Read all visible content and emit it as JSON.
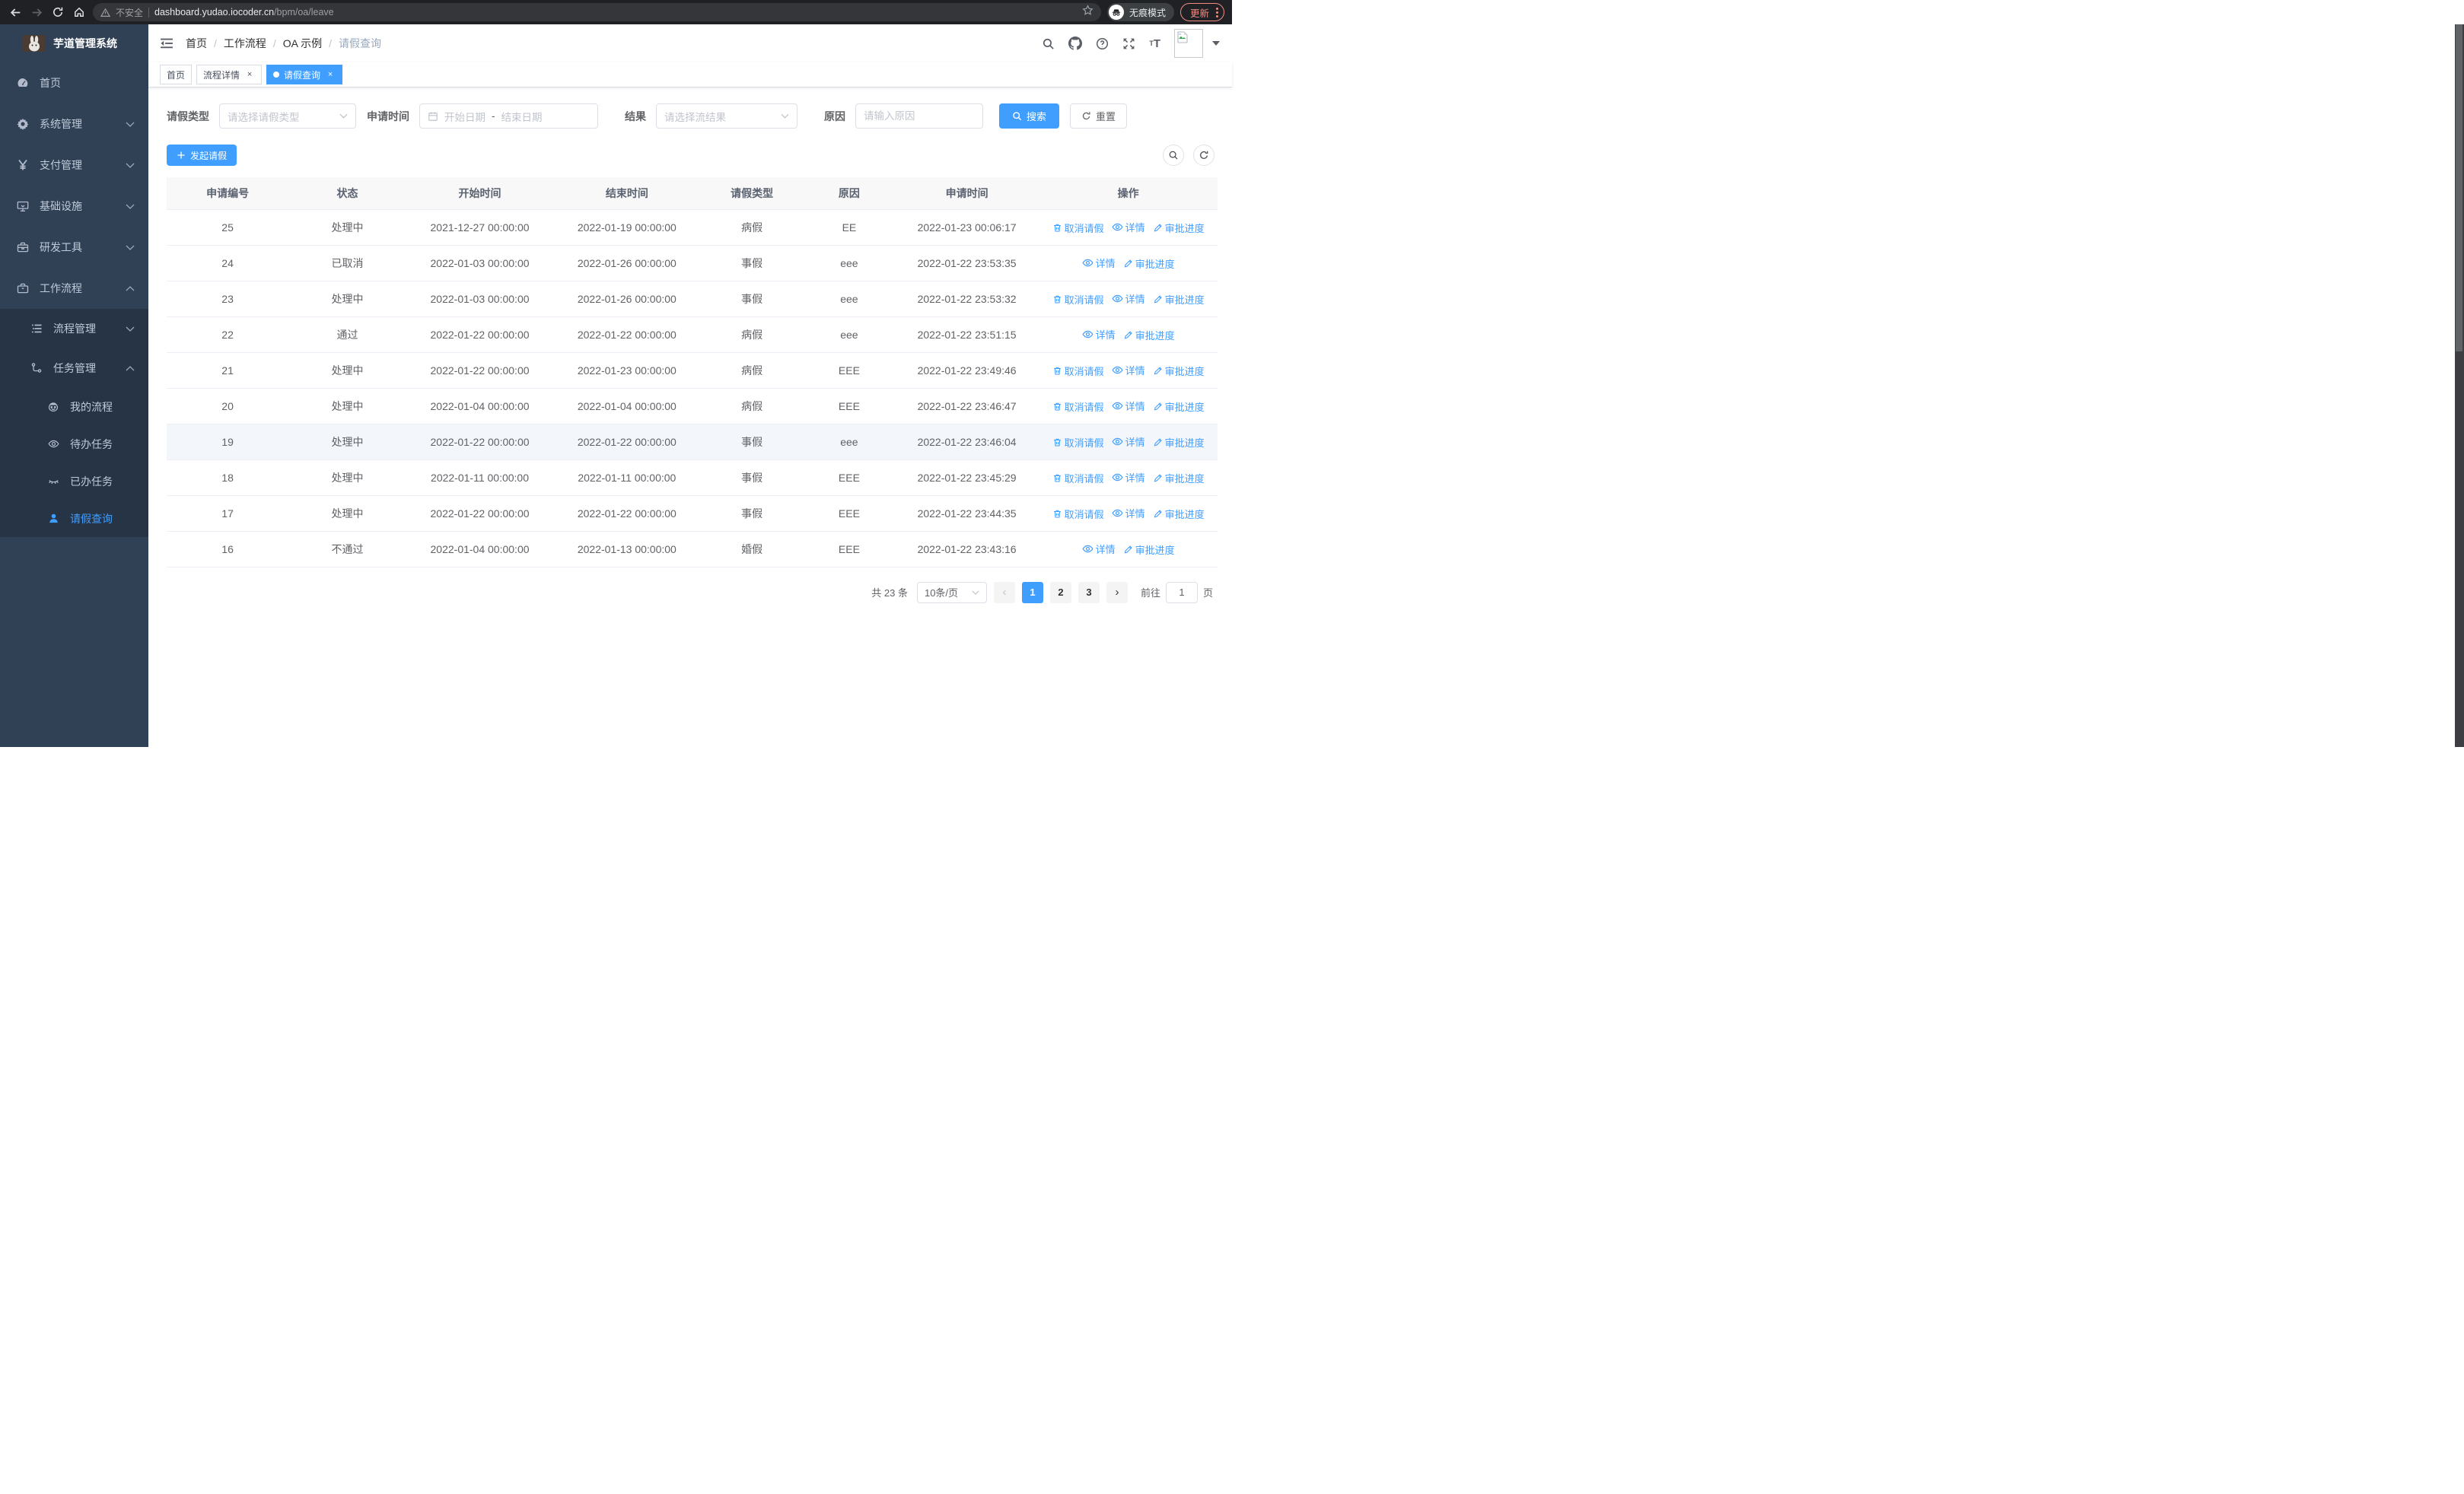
{
  "browser": {
    "security_text": "不安全",
    "url_host": "dashboard.yudao.iocoder.cn",
    "url_path": "/bpm/oa/leave",
    "incognito_label": "无痕模式",
    "update_label": "更新"
  },
  "sidebar": {
    "logo_title": "芋道管理系统",
    "menu": [
      {
        "label": "首页",
        "icon": "dashboard-icon",
        "level": 1,
        "chevron": "",
        "active": false
      },
      {
        "label": "系统管理",
        "icon": "gear-icon",
        "level": 1,
        "chevron": "down",
        "active": false
      },
      {
        "label": "支付管理",
        "icon": "yen-icon",
        "level": 1,
        "chevron": "down",
        "active": false
      },
      {
        "label": "基础设施",
        "icon": "monitor-icon",
        "level": 1,
        "chevron": "down",
        "active": false
      },
      {
        "label": "研发工具",
        "icon": "toolbox-icon",
        "level": 1,
        "chevron": "down",
        "active": false
      },
      {
        "label": "工作流程",
        "icon": "briefcase-icon",
        "level": 1,
        "chevron": "up",
        "active": false
      },
      {
        "label": "流程管理",
        "icon": "list-icon",
        "level": 2,
        "chevron": "down",
        "active": false,
        "sub": true
      },
      {
        "label": "任务管理",
        "icon": "branch-icon",
        "level": 2,
        "chevron": "up",
        "active": false,
        "sub": true
      },
      {
        "label": "我的流程",
        "icon": "robot-icon",
        "level": 3,
        "chevron": "",
        "active": false,
        "sub": true
      },
      {
        "label": "待办任务",
        "icon": "eye-icon",
        "level": 3,
        "chevron": "",
        "active": false,
        "sub": true
      },
      {
        "label": "已办任务",
        "icon": "eye-closed-icon",
        "level": 3,
        "chevron": "",
        "active": false,
        "sub": true
      },
      {
        "label": "请假查询",
        "icon": "user-icon",
        "level": 3,
        "chevron": "",
        "active": true,
        "sub": true
      }
    ]
  },
  "navbar": {
    "icons": [
      "search-icon",
      "github-icon",
      "help-icon",
      "fullscreen-icon",
      "font-size-icon"
    ]
  },
  "breadcrumb": {
    "items": [
      "首页",
      "工作流程",
      "OA 示例"
    ],
    "current": "请假查询"
  },
  "tabs": [
    {
      "label": "首页",
      "closable": false,
      "active": false
    },
    {
      "label": "流程详情",
      "closable": true,
      "active": false
    },
    {
      "label": "请假查询",
      "closable": true,
      "active": true
    }
  ],
  "filters": {
    "leave_type_label": "请假类型",
    "leave_type_placeholder": "请选择请假类型",
    "apply_time_label": "申请时间",
    "start_date_placeholder": "开始日期",
    "date_separator": "-",
    "end_date_placeholder": "结束日期",
    "result_label": "结果",
    "result_placeholder": "请选择流结果",
    "reason_label": "原因",
    "reason_placeholder": "请输入原因",
    "search_label": "搜索",
    "reset_label": "重置"
  },
  "toolbar": {
    "create_label": "发起请假"
  },
  "table": {
    "headers": [
      "申请编号",
      "状态",
      "开始时间",
      "结束时间",
      "请假类型",
      "原因",
      "申请时间",
      "操作"
    ],
    "action_labels": {
      "cancel": "取消请假",
      "detail": "详情",
      "progress": "审批进度"
    },
    "action_icons": {
      "cancel": "trash-icon",
      "detail": "eye-icon",
      "progress": "edit-icon"
    },
    "rows": [
      {
        "id": "25",
        "status": "处理中",
        "start": "2021-12-27 00:00:00",
        "end": "2022-01-19 00:00:00",
        "type": "病假",
        "reason": "EE",
        "applied": "2022-01-23 00:06:17",
        "actions": [
          "cancel",
          "detail",
          "progress"
        ],
        "highlight": false
      },
      {
        "id": "24",
        "status": "已取消",
        "start": "2022-01-03 00:00:00",
        "end": "2022-01-26 00:00:00",
        "type": "事假",
        "reason": "eee",
        "applied": "2022-01-22 23:53:35",
        "actions": [
          "detail",
          "progress"
        ],
        "highlight": false
      },
      {
        "id": "23",
        "status": "处理中",
        "start": "2022-01-03 00:00:00",
        "end": "2022-01-26 00:00:00",
        "type": "事假",
        "reason": "eee",
        "applied": "2022-01-22 23:53:32",
        "actions": [
          "cancel",
          "detail",
          "progress"
        ],
        "highlight": false
      },
      {
        "id": "22",
        "status": "通过",
        "start": "2022-01-22 00:00:00",
        "end": "2022-01-22 00:00:00",
        "type": "病假",
        "reason": "eee",
        "applied": "2022-01-22 23:51:15",
        "actions": [
          "detail",
          "progress"
        ],
        "highlight": false
      },
      {
        "id": "21",
        "status": "处理中",
        "start": "2022-01-22 00:00:00",
        "end": "2022-01-23 00:00:00",
        "type": "病假",
        "reason": "EEE",
        "applied": "2022-01-22 23:49:46",
        "actions": [
          "cancel",
          "detail",
          "progress"
        ],
        "highlight": false
      },
      {
        "id": "20",
        "status": "处理中",
        "start": "2022-01-04 00:00:00",
        "end": "2022-01-04 00:00:00",
        "type": "病假",
        "reason": "EEE",
        "applied": "2022-01-22 23:46:47",
        "actions": [
          "cancel",
          "detail",
          "progress"
        ],
        "highlight": false
      },
      {
        "id": "19",
        "status": "处理中",
        "start": "2022-01-22 00:00:00",
        "end": "2022-01-22 00:00:00",
        "type": "事假",
        "reason": "eee",
        "applied": "2022-01-22 23:46:04",
        "actions": [
          "cancel",
          "detail",
          "progress"
        ],
        "highlight": true
      },
      {
        "id": "18",
        "status": "处理中",
        "start": "2022-01-11 00:00:00",
        "end": "2022-01-11 00:00:00",
        "type": "事假",
        "reason": "EEE",
        "applied": "2022-01-22 23:45:29",
        "actions": [
          "cancel",
          "detail",
          "progress"
        ],
        "highlight": false
      },
      {
        "id": "17",
        "status": "处理中",
        "start": "2022-01-22 00:00:00",
        "end": "2022-01-22 00:00:00",
        "type": "事假",
        "reason": "EEE",
        "applied": "2022-01-22 23:44:35",
        "actions": [
          "cancel",
          "detail",
          "progress"
        ],
        "highlight": false
      },
      {
        "id": "16",
        "status": "不通过",
        "start": "2022-01-04 00:00:00",
        "end": "2022-01-13 00:00:00",
        "type": "婚假",
        "reason": "EEE",
        "applied": "2022-01-22 23:43:16",
        "actions": [
          "detail",
          "progress"
        ],
        "highlight": false
      }
    ]
  },
  "pagination": {
    "total_label": "共 23 条",
    "page_size_label": "10条/页",
    "pages": [
      "1",
      "2",
      "3"
    ],
    "current_page": "1",
    "goto_label": "前往",
    "goto_value": "1",
    "page_unit": "页"
  },
  "colors": {
    "accent": "#409eff",
    "sidebar_bg": "#304156",
    "submenu_bg": "#263445",
    "update_badge": "#f28b82"
  }
}
